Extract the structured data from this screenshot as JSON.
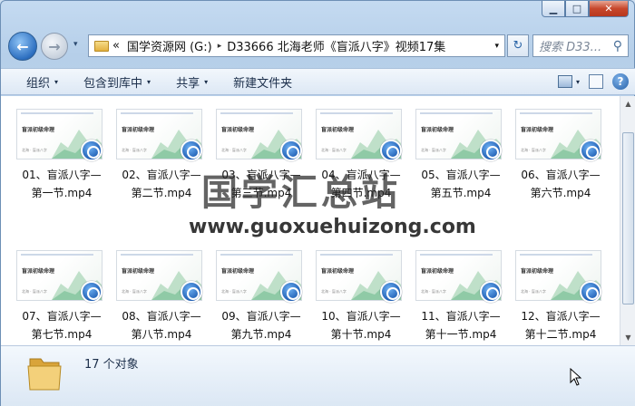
{
  "window": {
    "buttons": {
      "minimize": "▁",
      "maximize": "□",
      "close": "✕"
    }
  },
  "nav": {
    "back_icon": "arrow-left",
    "forward_icon": "arrow-right",
    "history_label": "▾",
    "path_prefix": "«",
    "path_segments": [
      "国学资源网 (G:)",
      "D33666 北海老师《盲派八字》视频17集"
    ],
    "path_sep": "▸",
    "dropdown": "▾",
    "refresh": "↻",
    "search_placeholder": "搜索 D33...",
    "search_icon": "⚲"
  },
  "toolbar": {
    "organize": "组织",
    "include_library": "包含到库中",
    "share": "共享",
    "new_folder": "新建文件夹",
    "arrow": "▾",
    "help": "?"
  },
  "thumbnail": {
    "title": "盲派初级命理",
    "subtitle": "北海 · 盲派八字"
  },
  "files": [
    {
      "name": "01、盲派八字—第一节.mp4"
    },
    {
      "name": "02、盲派八字—第二节.mp4"
    },
    {
      "name": "03、盲派八字—第三节.mp4"
    },
    {
      "name": "04、盲派八字—第四节.mp4"
    },
    {
      "name": "05、盲派八字—第五节.mp4"
    },
    {
      "name": "06、盲派八字—第六节.mp4"
    },
    {
      "name": "07、盲派八字—第七节.mp4"
    },
    {
      "name": "08、盲派八字—第八节.mp4"
    },
    {
      "name": "09、盲派八字—第九节.mp4"
    },
    {
      "name": "10、盲派八字—第十节.mp4"
    },
    {
      "name": "11、盲派八字—第十一节.mp4"
    },
    {
      "name": "12、盲派八字—第十二节.mp4"
    }
  ],
  "status": {
    "count": "17 个对象"
  },
  "watermark": {
    "cn": "国学汇总站",
    "url": "www.guoxuehuizong.com"
  },
  "colors": {
    "accent": "#2d6fc0",
    "close": "#c7472c",
    "folder": "#e3b13f"
  }
}
